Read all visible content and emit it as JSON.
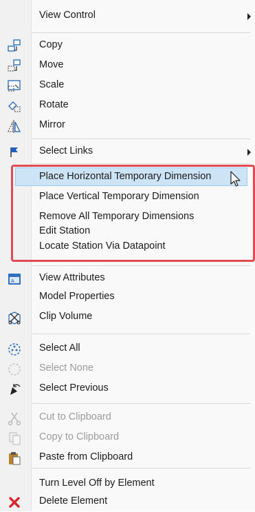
{
  "menu": {
    "items": [
      {
        "label": "View Control",
        "icon": "",
        "submenu": true,
        "disabled": false
      },
      {
        "label": "Copy",
        "icon": "copy-icon",
        "submenu": false,
        "disabled": false
      },
      {
        "label": "Move",
        "icon": "move-icon",
        "submenu": false,
        "disabled": false
      },
      {
        "label": "Scale",
        "icon": "scale-icon",
        "submenu": false,
        "disabled": false
      },
      {
        "label": "Rotate",
        "icon": "rotate-icon",
        "submenu": false,
        "disabled": false
      },
      {
        "label": "Mirror",
        "icon": "mirror-icon",
        "submenu": false,
        "disabled": false
      },
      {
        "label": "Select Links",
        "icon": "flag-icon",
        "submenu": true,
        "disabled": false
      },
      {
        "label": "Place Horizontal Temporary Dimension",
        "icon": "",
        "submenu": false,
        "disabled": false,
        "highlighted": true
      },
      {
        "label": "Place Vertical Temporary Dimension",
        "icon": "",
        "submenu": false,
        "disabled": false
      },
      {
        "label": "Remove All Temporary Dimensions",
        "icon": "",
        "submenu": false,
        "disabled": false
      },
      {
        "label": "Edit Station",
        "icon": "",
        "submenu": false,
        "disabled": false
      },
      {
        "label": "Locate Station Via Datapoint",
        "icon": "",
        "submenu": false,
        "disabled": false
      },
      {
        "label": "View Attributes",
        "icon": "attributes-icon",
        "submenu": false,
        "disabled": false
      },
      {
        "label": "Model Properties",
        "icon": "",
        "submenu": false,
        "disabled": false
      },
      {
        "label": "Clip Volume",
        "icon": "clip-volume-icon",
        "submenu": false,
        "disabled": false
      },
      {
        "label": "Select All",
        "icon": "select-all-icon",
        "submenu": false,
        "disabled": false
      },
      {
        "label": "Select None",
        "icon": "select-none-icon",
        "submenu": false,
        "disabled": true
      },
      {
        "label": "Select Previous",
        "icon": "select-previous-icon",
        "submenu": false,
        "disabled": false
      },
      {
        "label": "Cut to Clipboard",
        "icon": "scissors-icon",
        "submenu": false,
        "disabled": true
      },
      {
        "label": "Copy to Clipboard",
        "icon": "clipboard-copy-icon",
        "submenu": false,
        "disabled": true
      },
      {
        "label": "Paste from Clipboard",
        "icon": "paste-icon",
        "submenu": false,
        "disabled": false
      },
      {
        "label": "Turn Level Off by Element",
        "icon": "",
        "submenu": false,
        "disabled": false
      },
      {
        "label": "Delete Element",
        "icon": "delete-x-icon",
        "submenu": false,
        "disabled": false
      }
    ]
  },
  "colors": {
    "highlight": "#cde3f6",
    "annotation_box": "#e14a52",
    "delete_icon": "#d9262b"
  }
}
